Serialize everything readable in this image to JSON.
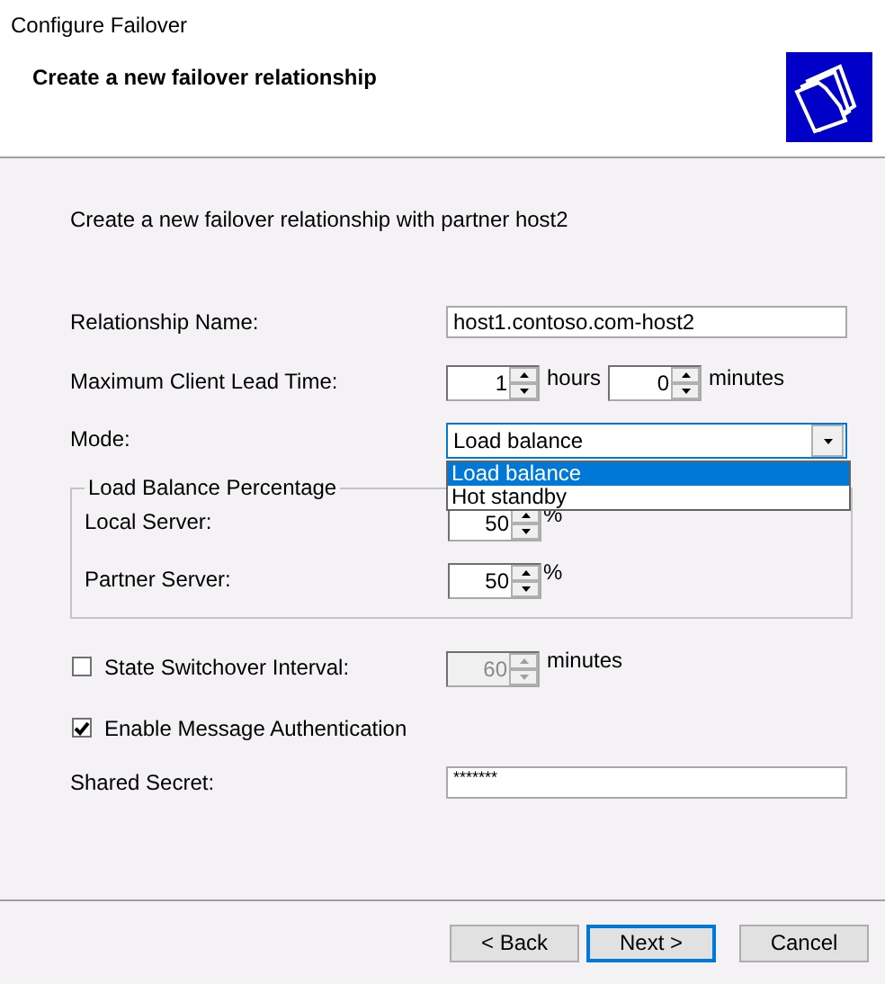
{
  "window": {
    "title": "Configure Failover"
  },
  "header": {
    "title": "Create a new failover relationship"
  },
  "intro": "Create a new failover relationship with partner host2",
  "relationship_name": {
    "label": "Relationship Name:",
    "value": "host1.contoso.com-host2"
  },
  "lead_time": {
    "label": "Maximum Client Lead Time:",
    "hours": {
      "value": "1",
      "unit": "hours"
    },
    "minutes": {
      "value": "0",
      "unit": "minutes"
    }
  },
  "mode": {
    "label": "Mode:",
    "value": "Load balance",
    "expanded": true,
    "options": [
      {
        "label": "Load balance",
        "selected": true
      },
      {
        "label": "Hot standby",
        "selected": false
      }
    ]
  },
  "load_balance": {
    "title": "Load Balance Percentage",
    "rows": [
      {
        "label": "Local Server:",
        "value": "50",
        "unit": "%"
      },
      {
        "label": "Partner Server:",
        "value": "50",
        "unit": "%"
      }
    ]
  },
  "switchover": {
    "label": "State Switchover Interval:",
    "checked": false,
    "disabled": true,
    "value": "60",
    "unit": "minutes"
  },
  "auth": {
    "label": "Enable Message Authentication",
    "checked": true
  },
  "secret": {
    "label": "Shared Secret:",
    "value": "*******"
  },
  "buttons": [
    {
      "label": "< Back",
      "default": false
    },
    {
      "label": "Next >",
      "default": true
    },
    {
      "label": "Cancel",
      "default": false
    }
  ]
}
